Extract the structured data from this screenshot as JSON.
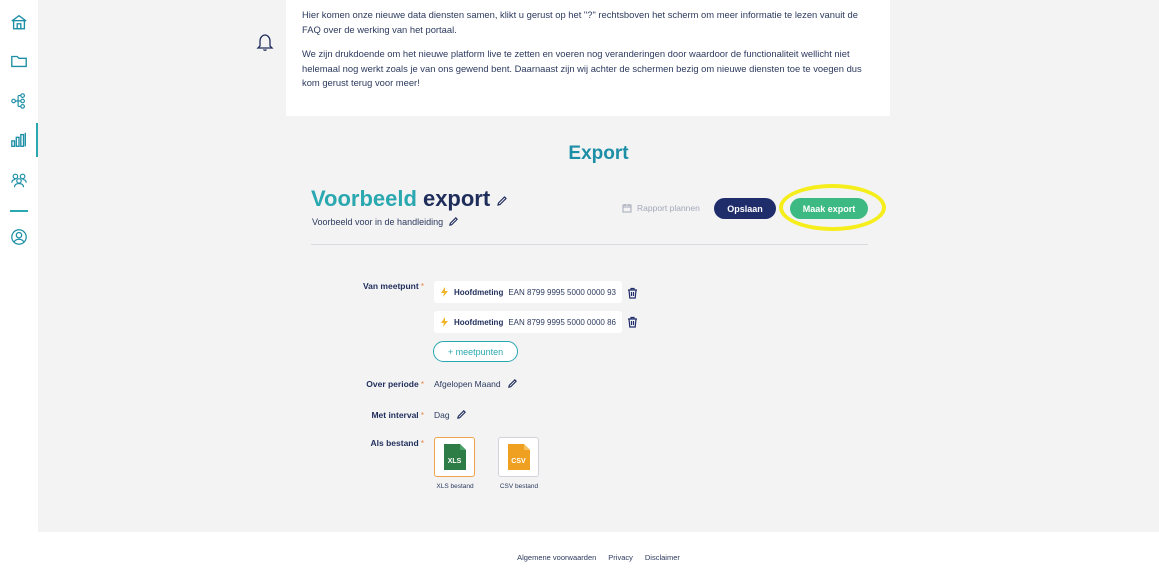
{
  "sidebar": {
    "items": [
      {
        "name": "home-icon"
      },
      {
        "name": "folder-icon"
      },
      {
        "name": "hierarchy-icon"
      },
      {
        "name": "bar-chart-icon"
      },
      {
        "name": "users-icon"
      },
      {
        "name": "profile-icon"
      }
    ],
    "active_index": 3,
    "accent": "#2aa8b0"
  },
  "notice": {
    "paragraph_1": "Hier komen onze nieuwe data diensten samen, klikt u gerust op het \"?\" rechtsboven het scherm om meer informatie te lezen vanuit de FAQ over de werking van het portaal.",
    "paragraph_2": "We zijn drukdoende om het nieuwe platform live te zetten en voeren nog veranderingen door waardoor de functionaliteit wellicht niet helemaal nog werkt zoals je van ons gewend bent. Daarnaast zijn wij achter de schermen bezig om nieuwe diensten toe te voegen dus kom gerust terug voor meer!"
  },
  "page": {
    "title": "Export"
  },
  "export": {
    "title_word1": "Voorbeeld",
    "title_word2": "export",
    "subtitle": "Voorbeeld voor in de handleiding",
    "schedule_label": "Rapport plannen",
    "save_label": "Opslaan",
    "export_label": "Maak export"
  },
  "form": {
    "meetpunt_label": "Van meetpunt",
    "meetpunten": [
      {
        "type": "Hoofdmeting",
        "ean": "EAN 8799 9995 5000 0000 93"
      },
      {
        "type": "Hoofdmeting",
        "ean": "EAN 8799 9995 5000 0000 86"
      }
    ],
    "add_meetpunt_label": "+ meetpunten",
    "periode_label": "Over periode",
    "periode_value": "Afgelopen Maand",
    "interval_label": "Met interval",
    "interval_value": "Dag",
    "bestand_label": "Als bestand",
    "files": [
      {
        "icon_text": "XLS",
        "label": "XLS bestand",
        "selected": true,
        "color": "#2e7d46"
      },
      {
        "icon_text": "CSV",
        "label": "CSV bestand",
        "selected": false,
        "color": "#f0a020"
      }
    ],
    "required_marker": "*"
  },
  "footer": {
    "links": [
      "Algemene voorwaarden",
      "Privacy",
      "Disclaimer"
    ]
  },
  "colors": {
    "primary_dark": "#1f2d6b",
    "teal": "#2aa8b0",
    "green": "#3dba83",
    "highlight": "#f5ee1a",
    "background": "#f3f3f4"
  }
}
